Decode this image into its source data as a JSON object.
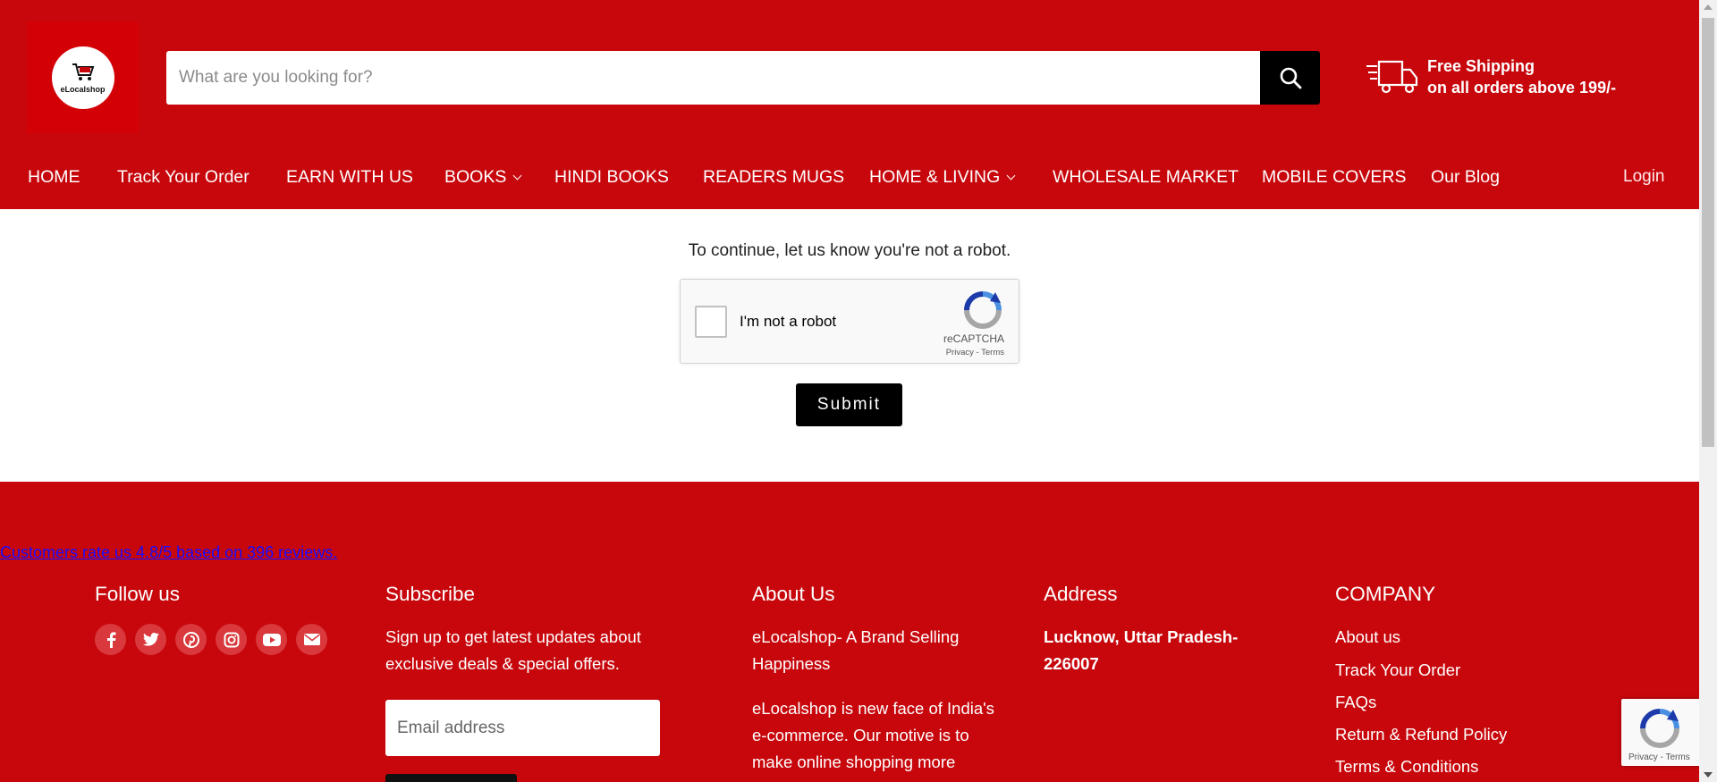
{
  "header": {
    "logo_text": "eLocalshop",
    "search_placeholder": "What are you looking for?",
    "shipping_line1": "Free Shipping",
    "shipping_line2": "on all orders above 199/-"
  },
  "nav": {
    "items": [
      {
        "label": "HOME"
      },
      {
        "label": "Track Your Order"
      },
      {
        "label": "EARN WITH US"
      },
      {
        "label": "BOOKS",
        "has_dropdown": true
      },
      {
        "label": "HINDI BOOKS"
      },
      {
        "label": "READERS MUGS"
      },
      {
        "label": "HOME & LIVING",
        "has_dropdown": true
      },
      {
        "label": "WHOLESALE MARKET"
      },
      {
        "label": "MOBILE COVERS"
      },
      {
        "label": "Our Blog"
      }
    ],
    "login": "Login"
  },
  "main": {
    "message": "To continue, let us know you're not a robot.",
    "captcha_label": "I'm not a robot",
    "captcha_brand": "reCAPTCHA",
    "captcha_links": "Privacy - Terms",
    "submit": "Submit"
  },
  "footer": {
    "reviews": "Customers rate us 4.8/5 based on 396 reviews.",
    "follow_title": "Follow us",
    "social_icons": [
      "facebook-icon",
      "twitter-icon",
      "pinterest-icon",
      "instagram-icon",
      "youtube-icon",
      "email-icon"
    ],
    "subscribe_title": "Subscribe",
    "subscribe_text": "Sign up to get latest updates about exclusive deals & special offers.",
    "email_placeholder": "Email address",
    "about_title": "About Us",
    "about_text1": "eLocalshop- A Brand Selling Happiness",
    "about_text2": "eLocalshop is new face of India's e-commerce. Our motive is to make online shopping more",
    "address_title": "Address",
    "address_text": "Lucknow, Uttar Pradesh- 226007",
    "company_title": "COMPANY",
    "company_links": [
      "About us",
      "Track Your Order",
      "FAQs",
      "Return & Refund Policy",
      "Terms & Conditions"
    ]
  },
  "recaptcha_badge": {
    "links": "Privacy - Terms"
  },
  "colors": {
    "brand_red": "#c7070c",
    "black": "#000000",
    "review_link": "#1a0dff"
  }
}
